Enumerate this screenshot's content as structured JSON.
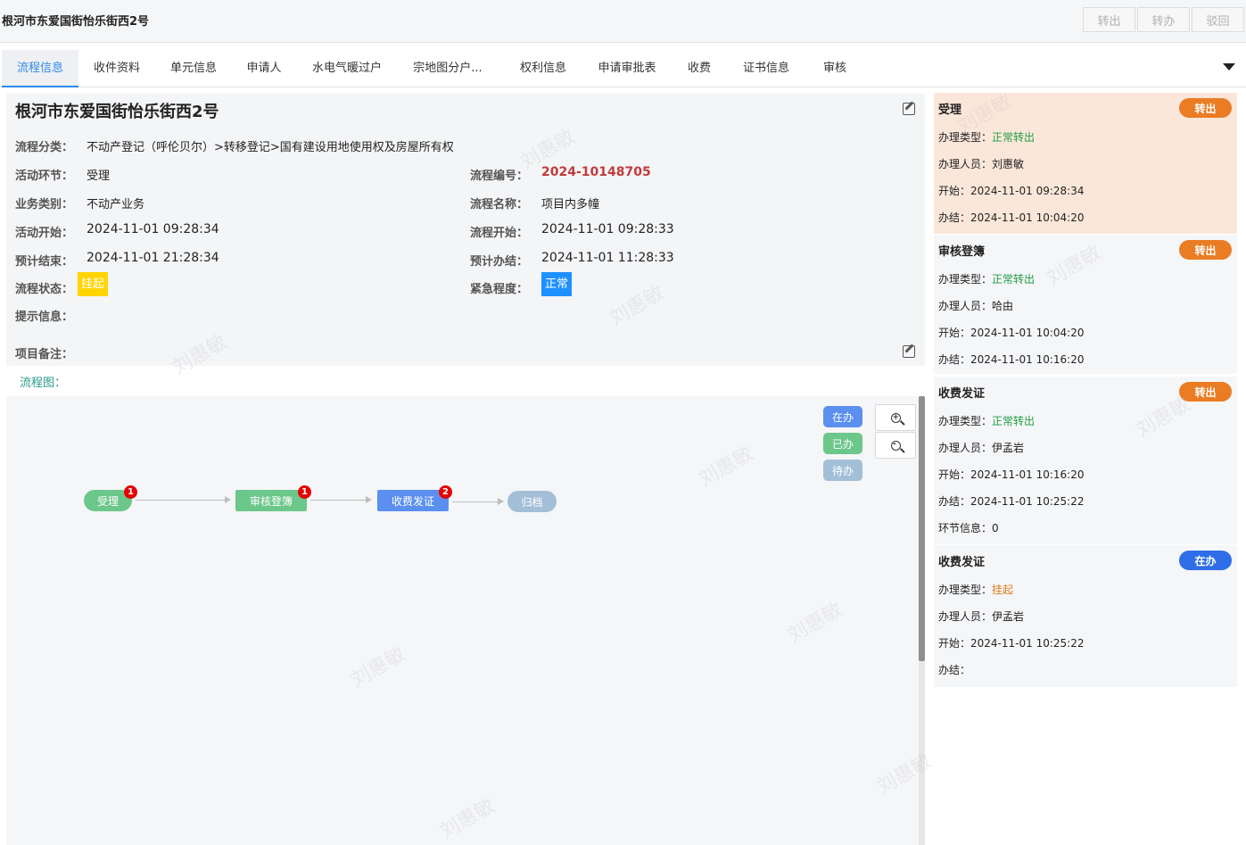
{
  "header": {
    "title": "根河市东爱国街怡乐街西2号",
    "buttons": [
      "转出",
      "转办",
      "驳回"
    ]
  },
  "tabs": [
    "流程信息",
    "收件资料",
    "单元信息",
    "申请人",
    "水电气暖过户",
    "宗地图分户...",
    "权利信息",
    "申请审批表",
    "收费",
    "证书信息",
    "审核"
  ],
  "info": {
    "title": "根河市东爱国街怡乐街西2号",
    "category_label": "流程分类：",
    "category": "不动产登记（呼伦贝尔）>转移登记>国有建设用地使用权及房屋所有权",
    "step_label": "活动环节：",
    "step": "受理",
    "biz_label": "业务类别：",
    "biz": "不动产业务",
    "act_start_label": "活动开始：",
    "act_start": "2024-11-01 09:28:34",
    "plan_end_label": "预计结束：",
    "plan_end": "2024-11-01 21:28:34",
    "status_label": "流程状态：",
    "status": "挂起",
    "hint_label": "提示信息：",
    "flow_no_label": "流程编号：",
    "flow_no": "2024-10148705",
    "flow_name_label": "流程名称：",
    "flow_name": "项目内多幢",
    "flow_start_label": "流程开始：",
    "flow_start": "2024-11-01 09:28:33",
    "plan_done_label": "预计办结：",
    "plan_done": "2024-11-01 11:28:33",
    "urgency_label": "紧急程度：",
    "urgency": "正常",
    "remark_label": "项目备注："
  },
  "flow": {
    "label": "流程图：",
    "legend": [
      "在办",
      "已办",
      "待办"
    ],
    "nodes": [
      {
        "label": "受理",
        "count": "1"
      },
      {
        "label": "审核登簿",
        "count": "1"
      },
      {
        "label": "收费发证",
        "count": "2"
      },
      {
        "label": "归档"
      }
    ]
  },
  "side": [
    {
      "title": "受理",
      "btn": "转出",
      "type_label": "办理类型：",
      "type": "正常转出",
      "person_label": "办理人员：",
      "person": "刘惠敏",
      "start_label": "开始：",
      "start": "2024-11-01 09:28:34",
      "end_label": "办结：",
      "end": "2024-11-01 10:04:20"
    },
    {
      "title": "审核登簿",
      "btn": "转出",
      "type_label": "办理类型：",
      "type": "正常转出",
      "person_label": "办理人员：",
      "person": "哈由",
      "start_label": "开始：",
      "start": "2024-11-01 10:04:20",
      "end_label": "办结：",
      "end": "2024-11-01 10:16:20"
    },
    {
      "title": "收费发证",
      "btn": "转出",
      "type_label": "办理类型：",
      "type": "正常转出",
      "person_label": "办理人员：",
      "person": "伊孟岩",
      "start_label": "开始：",
      "start": "2024-11-01 10:16:20",
      "end_label": "办结：",
      "end": "2024-11-01 10:25:22",
      "extra": "环节信息：0"
    },
    {
      "title": "收费发证",
      "btn": "在办",
      "type_label": "办理类型：",
      "type": "挂起",
      "person_label": "办理人员：",
      "person": "伊孟岩",
      "start_label": "开始：",
      "start": "2024-11-01 10:25:22",
      "end_label": "办结：",
      "end": ""
    }
  ],
  "watermark": "刘惠敏",
  "colors": {
    "accent": "#2e8ae6",
    "orange_btn": "#ea7c24",
    "blue_btn": "#2f6ee8",
    "done_green": "#6cc78a",
    "doing_blue": "#5b8ff0",
    "todo_grey": "#a3bfd8"
  }
}
